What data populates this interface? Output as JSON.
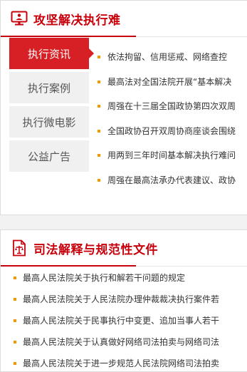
{
  "enforcement": {
    "title": "攻坚解决执行难",
    "icon": "monitor-person-icon",
    "tabs": [
      {
        "label": "执行资讯",
        "active": true
      },
      {
        "label": "执行案例",
        "active": false
      },
      {
        "label": "执行微电影",
        "active": false
      },
      {
        "label": "公益广告",
        "active": false
      }
    ],
    "news": [
      "依法拘留、信用惩戒、网络查控",
      "最高法对全国法院开展“基本解决",
      "周强在十三届全国政协第四次双周",
      "全国政协召开双周协商座谈会围绕",
      "用两到三年时间基本解决执行难问",
      "周强在最高法承办代表建议、政协"
    ]
  },
  "judicial": {
    "title": "司法解释与规范性文件",
    "icon": "document-scales-icon",
    "items": [
      "最高人民法院关于执行和解若干问题的规定",
      "最高人民法院关于人民法院办理仲裁裁决执行案件若",
      "最高人民法院关于民事执行中变更、追加当事人若干",
      "最高人民法院关于认真做好网络司法拍卖与网络司法",
      "最高人民法院关于进一步规范人民法院网络司法拍卖"
    ]
  },
  "colors": {
    "brand_red": "#c7000b",
    "tab_active": "#d62025",
    "bullet": "#f39800"
  }
}
